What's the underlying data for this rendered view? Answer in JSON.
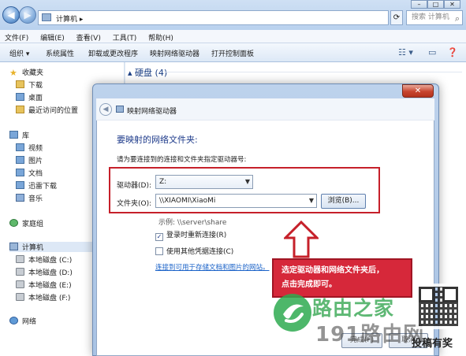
{
  "explorer": {
    "address_crumb": "计算机",
    "search_placeholder": "搜索 计算机",
    "menu": [
      "文件(F)",
      "编辑(E)",
      "查看(V)",
      "工具(T)",
      "帮助(H)"
    ],
    "toolbar": [
      "组织 ▾",
      "系统属性",
      "卸载或更改程序",
      "映射网络驱动器",
      "打开控制面板"
    ],
    "nav": {
      "favorites": "收藏夹",
      "downloads": "下载",
      "desktop": "桌面",
      "recent": "最近访问的位置",
      "libraries": "库",
      "videos": "视频",
      "pictures": "图片",
      "documents": "文档",
      "thunder": "迅雷下载",
      "music": "音乐",
      "homegroup": "家庭组",
      "computer": "计算机",
      "drive_c": "本地磁盘 (C:)",
      "drive_d": "本地磁盘 (D:)",
      "drive_e": "本地磁盘 (E:)",
      "drive_f": "本地磁盘 (F:)",
      "network": "网络"
    },
    "hard_disks_header": "硬盘 (4)"
  },
  "dialog": {
    "title": "映射网络驱动器",
    "heading": "要映射的网络文件夹:",
    "instruction": "请为要连接到的连接和文件夹指定驱动器号:",
    "drive_label": "驱动器(D):",
    "drive_value": "Z:",
    "folder_label": "文件夹(O):",
    "folder_value": "\\\\XIAOMI\\XiaoMi",
    "browse_button": "浏览(B)...",
    "example": "示例: \\\\server\\share",
    "reconnect_label": "登录时重新连接(R)",
    "reconnect_checked": true,
    "other_credentials_label": "使用其他凭据连接(C)",
    "other_credentials_checked": false,
    "link": "连接到可用于存储文档和图片的网站。",
    "finish_button": "完成(F)",
    "cancel_button": "取消",
    "close_glyph": "✕"
  },
  "annotation": {
    "callout_line1": "选定驱动器和网络文件夹后，",
    "callout_line2": "点击完成即可。",
    "box_color": "#c6202a",
    "callout_color": "#d6283a"
  },
  "watermark": {
    "line1": "路由之家",
    "line2": "191路由网",
    "site": "投稿有奖"
  }
}
